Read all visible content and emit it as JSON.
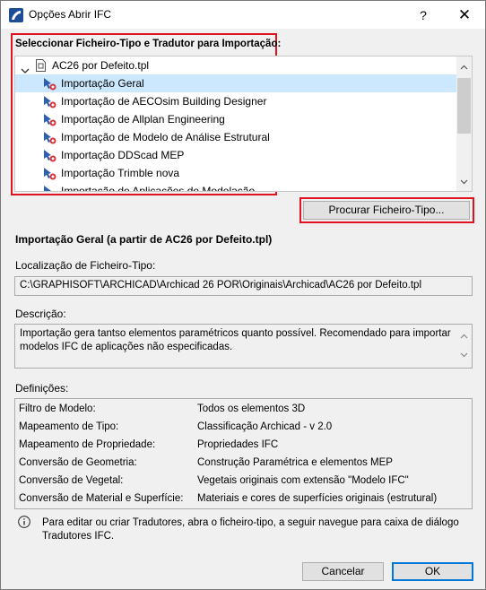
{
  "window": {
    "title": "Opções Abrir IFC",
    "help_label": "?",
    "close_label": "✕"
  },
  "selector": {
    "heading": "Seleccionar Ficheiro-Tipo e Tradutor para Importação:",
    "template": "AC26 por Defeito.tpl",
    "items": [
      "Importação Geral",
      "Importação de AECOsim Building Designer",
      "Importação de Allplan Engineering",
      "Importação de Modelo de Análise Estrutural",
      "Importação DDScad MEP",
      "Importação Trimble nova",
      "Importação de Aplicações de Modelação"
    ],
    "selected_index": 0,
    "browse_label": "Procurar Ficheiro-Tipo..."
  },
  "details": {
    "heading": "Importação Geral (a partir de AC26 por Defeito.tpl)",
    "location_label": "Localização de Ficheiro-Tipo:",
    "location_value": "C:\\GRAPHISOFT\\ARCHICAD\\Archicad 26 POR\\Originais\\Archicad\\AC26 por Defeito.tpl",
    "description_label": "Descrição:",
    "description_value": "Importação gera tantso elementos paramétricos quanto possível. Recomendado para importar modelos IFC de aplicações não especificadas.",
    "definitions_label": "Definições:",
    "definitions": [
      {
        "key": "Filtro de Modelo:",
        "value": "Todos os elementos 3D"
      },
      {
        "key": "Mapeamento de Tipo:",
        "value": "Classificação Archicad - v 2.0"
      },
      {
        "key": "Mapeamento de Propriedade:",
        "value": "Propriedades IFC"
      },
      {
        "key": "Conversão de Geometria:",
        "value": "Construção Paramétrica e elementos MEP"
      },
      {
        "key": "Conversão de Vegetal:",
        "value": "Vegetais originais com extensão \"Modelo IFC\""
      },
      {
        "key": "Conversão de Material e Superfície:",
        "value": "Materiais e cores de superfícies originais (estrutural)"
      }
    ]
  },
  "info": {
    "icon": "info-icon",
    "text": "Para editar ou criar Tradutores, abra o ficheiro-tipo, a seguir navegue para caixa de diálogo Tradutores IFC."
  },
  "footer": {
    "cancel_label": "Cancelar",
    "ok_label": "OK"
  },
  "colors": {
    "highlight": "#e0141e",
    "selection": "#cce8ff",
    "accent": "#0078d7"
  }
}
